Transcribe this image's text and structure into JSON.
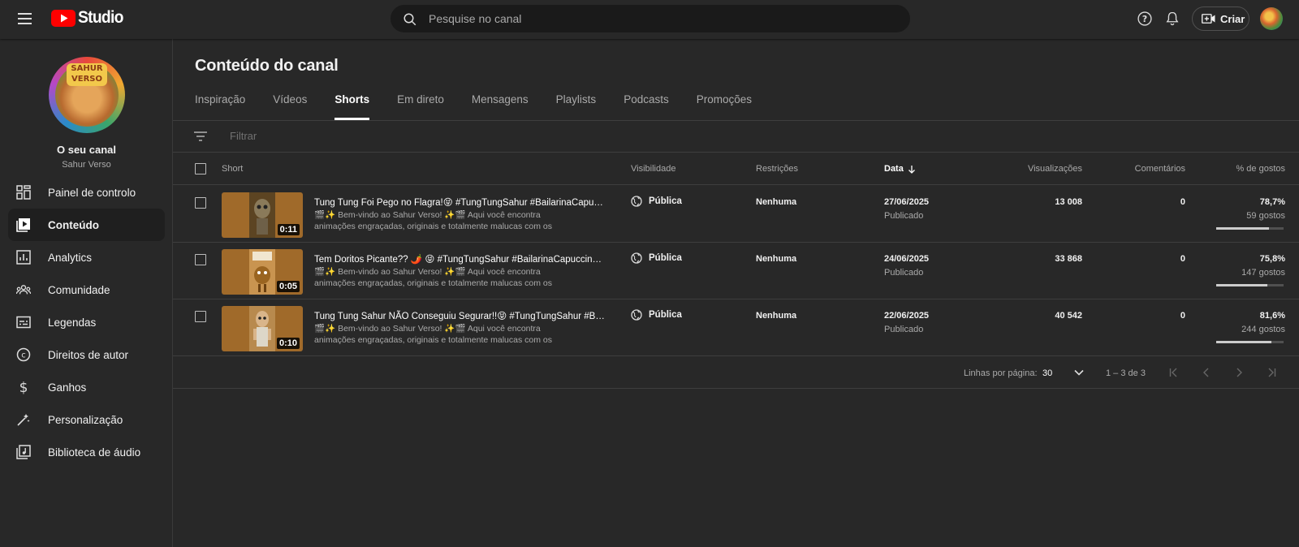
{
  "header": {
    "logo_text": "Studio",
    "search_placeholder": "Pesquise no canal",
    "create_label": "Criar"
  },
  "sidebar": {
    "channel_title": "O seu canal",
    "channel_name": "Sahur Verso",
    "avatar_badge": "SAHUR VERSO",
    "items": [
      {
        "label": "Painel de controlo",
        "icon": "dashboard-icon"
      },
      {
        "label": "Conteúdo",
        "icon": "content-icon",
        "active": true
      },
      {
        "label": "Analytics",
        "icon": "analytics-icon"
      },
      {
        "label": "Comunidade",
        "icon": "community-icon"
      },
      {
        "label": "Legendas",
        "icon": "subtitles-icon"
      },
      {
        "label": "Direitos de autor",
        "icon": "copyright-icon"
      },
      {
        "label": "Ganhos",
        "icon": "earn-icon"
      },
      {
        "label": "Personalização",
        "icon": "customization-icon"
      },
      {
        "label": "Biblioteca de áudio",
        "icon": "audio-library-icon"
      }
    ]
  },
  "main": {
    "title": "Conteúdo do canal",
    "tabs": [
      {
        "label": "Inspiração"
      },
      {
        "label": "Vídeos"
      },
      {
        "label": "Shorts",
        "active": true
      },
      {
        "label": "Em direto"
      },
      {
        "label": "Mensagens"
      },
      {
        "label": "Playlists"
      },
      {
        "label": "Podcasts"
      },
      {
        "label": "Promoções"
      }
    ],
    "filter_placeholder": "Filtrar",
    "columns": {
      "short": "Short",
      "visibility": "Visibilidade",
      "restrictions": "Restrições",
      "date": "Data",
      "views": "Visualizações",
      "comments": "Comentários",
      "likes": "% de gostos"
    },
    "rows": [
      {
        "title": "Tung Tung Foi Pego no Flagra!😝 #TungTungSahur #BailarinaCapuccino #sahur",
        "desc": "🎬✨ Bem-vindo ao Sahur Verso! ✨🎬 Aqui você encontra animações engraçadas, originais e totalmente malucas com os personagens mais...",
        "duration": "0:11",
        "visibility": "Pública",
        "restrictions": "Nenhuma",
        "date": "27/06/2025",
        "status": "Publicado",
        "views": "13 008",
        "comments": "0",
        "likes_pct": "78,7%",
        "likes_count": "59 gostos",
        "likes_ratio": 0.787
      },
      {
        "title": "Tem Doritos Picante?? 🌶️ 😝 #TungTungSahur #BailarinaCapuccino #sahur",
        "desc": "🎬✨ Bem-vindo ao Sahur Verso! ✨🎬 Aqui você encontra animações engraçadas, originais e totalmente malucas com os personagens mais...",
        "duration": "0:05",
        "visibility": "Pública",
        "restrictions": "Nenhuma",
        "date": "24/06/2025",
        "status": "Publicado",
        "views": "33 868",
        "comments": "0",
        "likes_pct": "75,8%",
        "likes_count": "147 gostos",
        "likes_ratio": 0.758
      },
      {
        "title": "Tung Tung Sahur NÃO Conseguiu Segurar!!😝 #TungTungSahur #BailarinaCapuccino",
        "desc": "🎬✨ Bem-vindo ao Sahur Verso! ✨🎬 Aqui você encontra animações engraçadas, originais e totalmente malucas com os personagens mais...",
        "duration": "0:10",
        "visibility": "Pública",
        "restrictions": "Nenhuma",
        "date": "22/06/2025",
        "status": "Publicado",
        "views": "40 542",
        "comments": "0",
        "likes_pct": "81,6%",
        "likes_count": "244 gostos",
        "likes_ratio": 0.816
      }
    ],
    "pagination": {
      "rows_per_page_label": "Linhas por página:",
      "rows_per_page": "30",
      "range": "1 – 3 de 3"
    }
  }
}
